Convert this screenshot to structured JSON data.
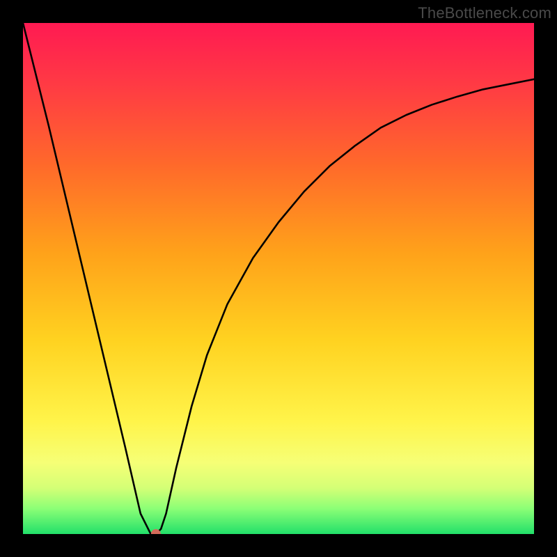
{
  "watermark": "TheBottleneck.com",
  "chart_data": {
    "type": "line",
    "title": "",
    "xlabel": "",
    "ylabel": "",
    "xlim": [
      0,
      100
    ],
    "ylim": [
      0,
      100
    ],
    "grid": false,
    "series": [
      {
        "name": "bottleneck-curve",
        "x": [
          0,
          5,
          10,
          15,
          20,
          23,
          25,
          26,
          27,
          28,
          30,
          33,
          36,
          40,
          45,
          50,
          55,
          60,
          65,
          70,
          75,
          80,
          85,
          90,
          95,
          100
        ],
        "values": [
          100,
          80,
          59,
          38,
          17,
          4,
          0,
          0,
          1,
          4,
          13,
          25,
          35,
          45,
          54,
          61,
          67,
          72,
          76,
          79.5,
          82,
          84,
          85.6,
          87,
          88,
          89
        ]
      }
    ],
    "marker": {
      "x": 26,
      "y": 0,
      "color": "#d36a5a",
      "radius_px": 7
    }
  }
}
